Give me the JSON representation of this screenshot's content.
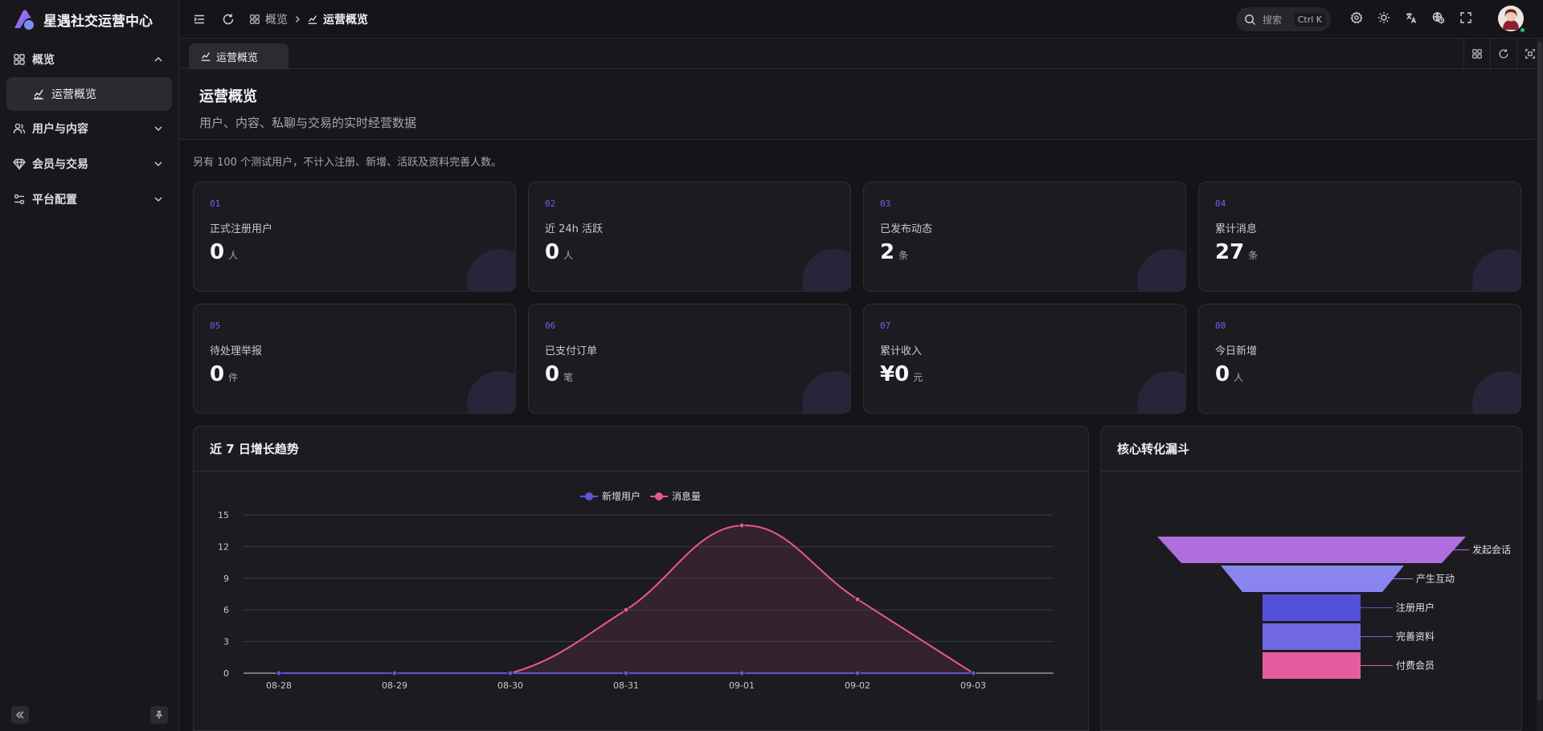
{
  "app": {
    "title": "星遇社交运营中心"
  },
  "sidebar": {
    "items": [
      {
        "label": "概览",
        "expanded": true
      },
      {
        "label": "运营概览",
        "active": true
      },
      {
        "label": "用户与内容"
      },
      {
        "label": "会员与交易"
      },
      {
        "label": "平台配置"
      }
    ]
  },
  "header": {
    "breadcrumb": [
      "概览",
      "运营概览"
    ],
    "search_label": "搜索",
    "search_shortcut": "Ctrl K"
  },
  "tabs": [
    {
      "label": "运营概览"
    }
  ],
  "page": {
    "title": "运营概览",
    "subtitle": "用户、内容、私聊与交易的实时经营数据",
    "note": "另有 100 个测试用户，不计入注册、新增、活跃及资料完善人数。"
  },
  "stats": [
    {
      "num": "01",
      "label": "正式注册用户",
      "value": "0",
      "unit": "人"
    },
    {
      "num": "02",
      "label": "近 24h 活跃",
      "value": "0",
      "unit": "人"
    },
    {
      "num": "03",
      "label": "已发布动态",
      "value": "2",
      "unit": "条"
    },
    {
      "num": "04",
      "label": "累计消息",
      "value": "27",
      "unit": "条"
    },
    {
      "num": "05",
      "label": "待处理举报",
      "value": "0",
      "unit": "件"
    },
    {
      "num": "06",
      "label": "已支付订单",
      "value": "0",
      "unit": "笔"
    },
    {
      "num": "07",
      "label": "累计收入",
      "value": "¥0",
      "unit": "元"
    },
    {
      "num": "08",
      "label": "今日新增",
      "value": "0",
      "unit": "人"
    }
  ],
  "panels": {
    "trend_title": "近 7 日增长趋势",
    "funnel_title": "核心转化漏斗"
  },
  "chart_data": [
    {
      "type": "line",
      "title": "近 7 日增长趋势",
      "categories": [
        "08-28",
        "08-29",
        "08-30",
        "08-31",
        "09-01",
        "09-02",
        "09-03"
      ],
      "series": [
        {
          "name": "新增用户",
          "values": [
            0,
            0,
            0,
            0,
            0,
            0,
            0
          ],
          "color": "#5b57d9"
        },
        {
          "name": "消息量",
          "values": [
            0,
            0,
            0,
            6,
            14,
            7,
            0
          ],
          "color": "#e9559b"
        }
      ],
      "yticks": [
        0,
        3,
        6,
        9,
        12,
        15
      ],
      "ylim": [
        0,
        15
      ],
      "legend": "top-center"
    },
    {
      "type": "funnel",
      "title": "核心转化漏斗",
      "stages": [
        {
          "label": "发起会话",
          "color": "#b06ddd"
        },
        {
          "label": "产生互动",
          "color": "#8a84ee"
        },
        {
          "label": "注册用户",
          "color": "#5650d8"
        },
        {
          "label": "完善资料",
          "color": "#6f68e2"
        },
        {
          "label": "付费会员",
          "color": "#e35da0"
        }
      ]
    }
  ]
}
